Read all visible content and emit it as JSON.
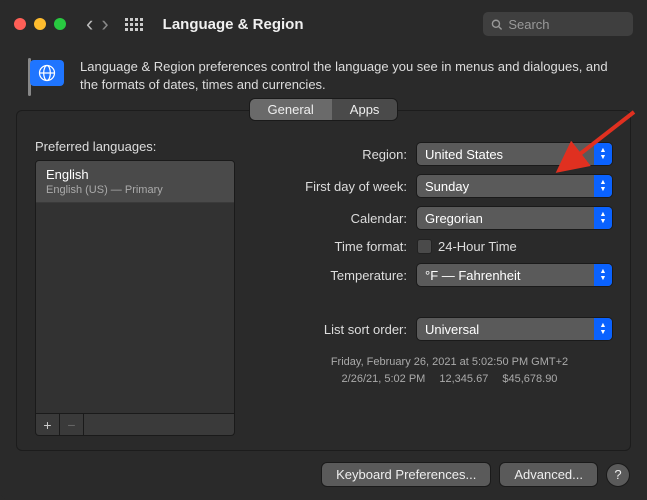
{
  "titlebar": {
    "title": "Language & Region",
    "search_placeholder": "Search"
  },
  "description": "Language & Region preferences control the language you see in menus and dialogues, and the formats of dates, times and currencies.",
  "tabs": {
    "general": "General",
    "apps": "Apps"
  },
  "preferred_languages_label": "Preferred languages:",
  "languages": [
    {
      "name": "English",
      "sub": "English (US) — Primary"
    }
  ],
  "rows": {
    "region_label": "Region:",
    "region_value": "United States",
    "firstday_label": "First day of week:",
    "firstday_value": "Sunday",
    "calendar_label": "Calendar:",
    "calendar_value": "Gregorian",
    "timeformat_label": "Time format:",
    "timeformat_value": "24-Hour Time",
    "temperature_label": "Temperature:",
    "temperature_value": "°F — Fahrenheit",
    "listsort_label": "List sort order:",
    "listsort_value": "Universal"
  },
  "sample": {
    "line1": "Friday, February 26, 2021 at 5:02:50 PM GMT+2",
    "line2": "2/26/21, 5:02 PM  12,345.67  $45,678.90"
  },
  "bottom": {
    "keyboard": "Keyboard Preferences...",
    "advanced": "Advanced...",
    "help": "?"
  }
}
